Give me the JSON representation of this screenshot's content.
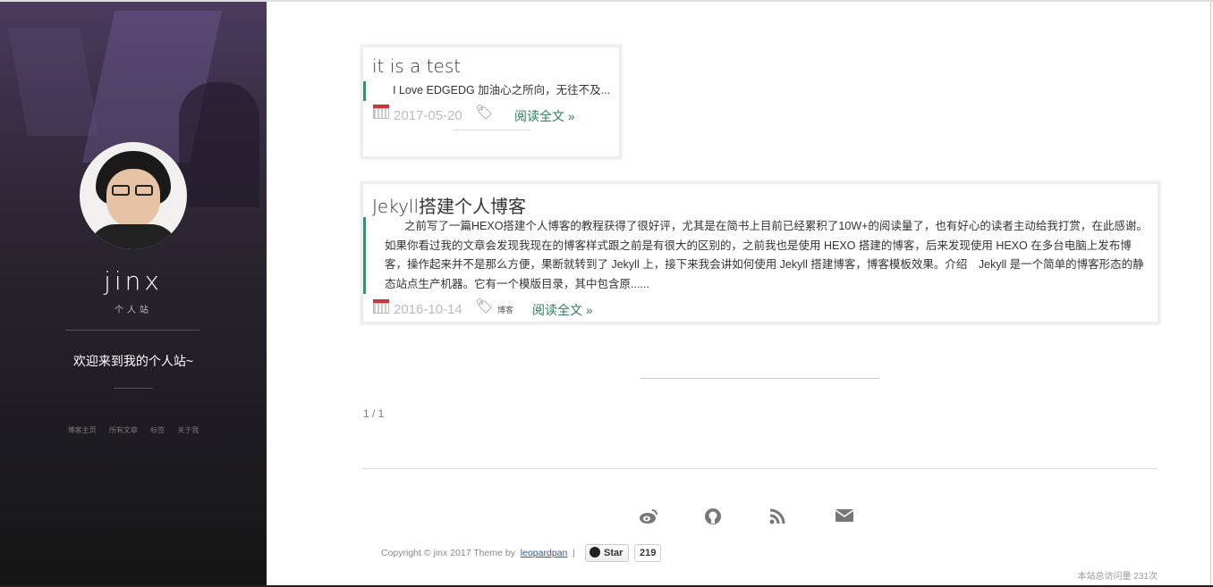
{
  "sidebar": {
    "name": "jinx",
    "subtitle": "个人站",
    "welcome": "欢迎来到我的个人站~",
    "nav": [
      "博客主页",
      "所有文章",
      "标签",
      "关于我"
    ]
  },
  "posts": [
    {
      "title": "it is a test",
      "excerpt": "I Love EDGEDG 加油心之所向，无往不及...",
      "date": "2017-05-20",
      "tag": "",
      "read_more": "阅读全文 »"
    },
    {
      "title": "Jekyll搭建个人博客",
      "excerpt": "之前写了一篇HEXO搭建个人博客的教程获得了很好评，尤其是在简书上目前已经累积了10W+的阅读量了，也有好心的读者主动给我打赏，在此感谢。　如果你看过我的文章会发现我现在的博客样式跟之前是有很大的区别的，之前我也是使用 HEXO 搭建的博客，后来发现使用 HEXO 在多台电脑上发布博客，操作起来并不是那么方便，果断就转到了 Jekyll 上，接下来我会讲如何使用 Jekyll 搭建博客，博客模板效果。介绍　Jekyll 是一个简单的博客形态的静态站点生产机器。它有一个模版目录，其中包含原......",
      "date": "2016-10-14",
      "tag": "博客",
      "read_more": "阅读全文 »"
    }
  ],
  "pagination": "1 / 1",
  "footer": {
    "social_icons": [
      "weibo-icon",
      "github-icon",
      "rss-icon",
      "email-icon"
    ],
    "copyright_prefix": "Copyright © jinx 2017 Theme by",
    "author_link": "leopardpan",
    "separator": "|",
    "star_label": "Star",
    "star_count": "219",
    "visits": "本站总访问量 231次"
  },
  "colors": {
    "accent": "#3e8e72",
    "link": "#2f7a5c"
  }
}
